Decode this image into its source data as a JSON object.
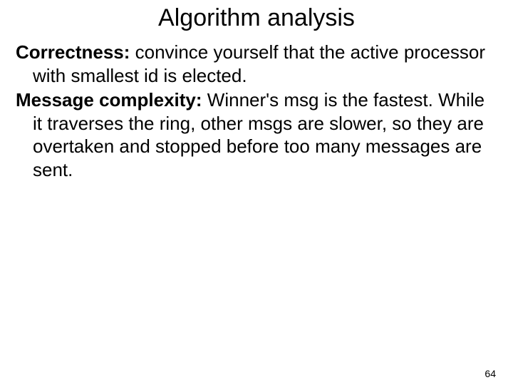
{
  "title": "Algorithm analysis",
  "correctness_label": "Correctness: ",
  "correctness_text": " convince yourself that the active processor with smallest id is elected.",
  "msgcomplex_label": "Message complexity:",
  "msgcomplex_text": " Winner's msg is the fastest.  While it traverses the ring, other msgs are slower, so they are overtaken and stopped before too many messages are sent.",
  "page_number": "64"
}
